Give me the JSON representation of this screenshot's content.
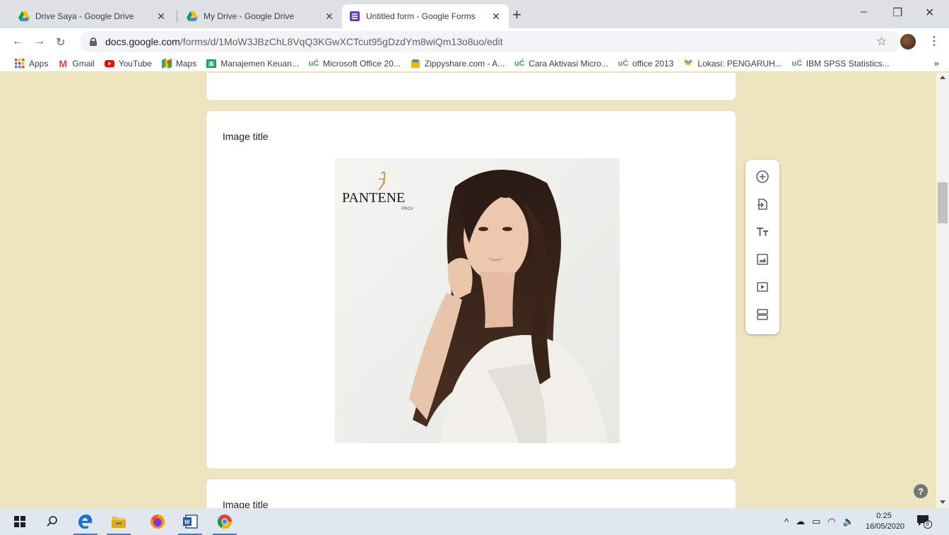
{
  "browser": {
    "tabs": [
      {
        "title": "Drive Saya - Google Drive",
        "icon": "google-drive-icon",
        "active": false
      },
      {
        "title": "My Drive - Google Drive",
        "icon": "google-drive-icon",
        "active": false
      },
      {
        "title": "Untitled form - Google Forms",
        "icon": "google-forms-icon",
        "active": true
      }
    ],
    "window_controls": {
      "minimize": "–",
      "maximize": "❐",
      "close": "✕"
    },
    "url_host": "docs.google.com",
    "url_path": "/forms/d/1MoW3JBzChL8VqQ3KGwXCTcut95gDzdYm8wiQm13o8uo/edit",
    "bookmarks": [
      {
        "label": "Apps",
        "icon": "apps-grid-icon"
      },
      {
        "label": "Gmail",
        "icon": "gmail-icon"
      },
      {
        "label": "YouTube",
        "icon": "youtube-icon"
      },
      {
        "label": "Maps",
        "icon": "maps-icon"
      },
      {
        "label": "Manajemen Keuan...",
        "icon": "classroom-icon"
      },
      {
        "label": "Microsoft Office 20...",
        "icon": "uc-icon"
      },
      {
        "label": "Zippyshare.com - A...",
        "icon": "zippyshare-icon"
      },
      {
        "label": "Cara Aktivasi Micro...",
        "icon": "uc-icon"
      },
      {
        "label": "office 2013",
        "icon": "uc-icon"
      },
      {
        "label": "Lokasi: PENGARUH...",
        "icon": "lokasi-icon"
      },
      {
        "label": "IBM SPSS Statistics...",
        "icon": "uc-icon"
      }
    ],
    "bookmarks_more": "»"
  },
  "form": {
    "image_item_title": "Image title",
    "next_item_title": "Image title",
    "image": {
      "brand_logo": "PANTENE",
      "brand_sub": "PROV"
    },
    "side_toolbar": [
      "add-question-icon",
      "import-questions-icon",
      "add-title-icon",
      "add-image-icon",
      "add-video-icon",
      "add-section-icon"
    ],
    "help_label": "?"
  },
  "taskbar": {
    "apps": [
      "windows-start-icon",
      "search-icon",
      "edge-icon",
      "file-explorer-icon",
      "firefox-icon",
      "word-icon",
      "chrome-icon"
    ],
    "time": "0:25",
    "date": "16/05/2020",
    "notification_count": "8"
  }
}
